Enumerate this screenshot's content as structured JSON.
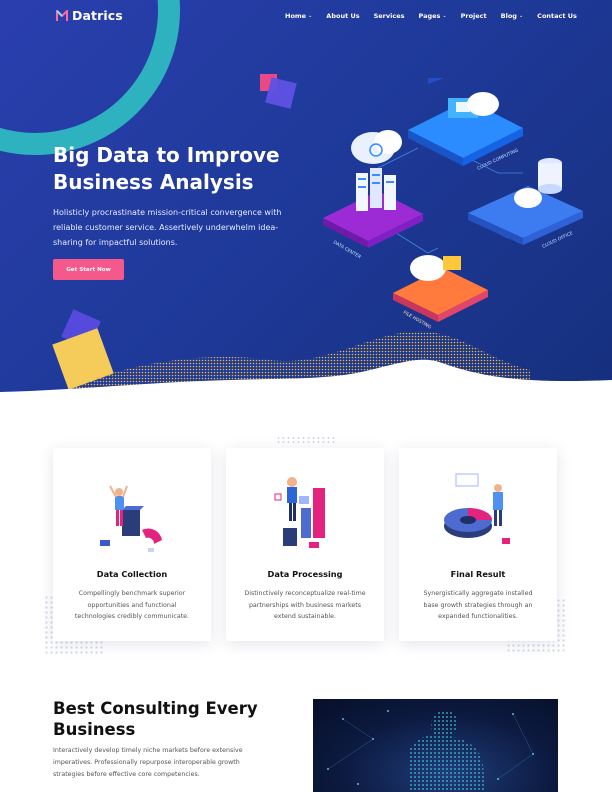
{
  "brand": {
    "name": "Datrics",
    "accent": "#f5588a",
    "primary": "#1f3a9b",
    "teal": "#2fb2c0"
  },
  "nav": {
    "items": [
      {
        "label": "Home",
        "dropdown": true
      },
      {
        "label": "About Us",
        "dropdown": false
      },
      {
        "label": "Services",
        "dropdown": false
      },
      {
        "label": "Pages",
        "dropdown": true
      },
      {
        "label": "Project",
        "dropdown": false
      },
      {
        "label": "Blog",
        "dropdown": true
      },
      {
        "label": "Contact Us",
        "dropdown": false
      }
    ],
    "caret": "⌄"
  },
  "hero": {
    "title": "Big Data to Improve Business Analysis",
    "description": "Holisticly procrastinate mission-critical convergence with reliable customer service. Assertively underwhelm idea-sharing for impactful solutions.",
    "cta_label": "Get Start Now",
    "illustration_labels": [
      "DATA CENTER",
      "CLOUD COMPUTING",
      "CLOUD OFFICE",
      "FILE HOSTING"
    ]
  },
  "features": [
    {
      "title": "Data Collection",
      "text": "Compellingly benchmark superior opportunities and functional technologies credibly communicate."
    },
    {
      "title": "Data Processing",
      "text": "Distinctively reconceptualize real-time partnerships with business markets extend sustainable."
    },
    {
      "title": "Final Result",
      "text": "Synergistically aggregate installed base growth strategies through an expanded functionalities."
    }
  ],
  "consulting": {
    "title": "Best Consulting Every Business",
    "text": "Interactively develop timely niche markets before extensive imperatives. Professionally repurpose interoperable growth strategies before effective core competencies."
  }
}
